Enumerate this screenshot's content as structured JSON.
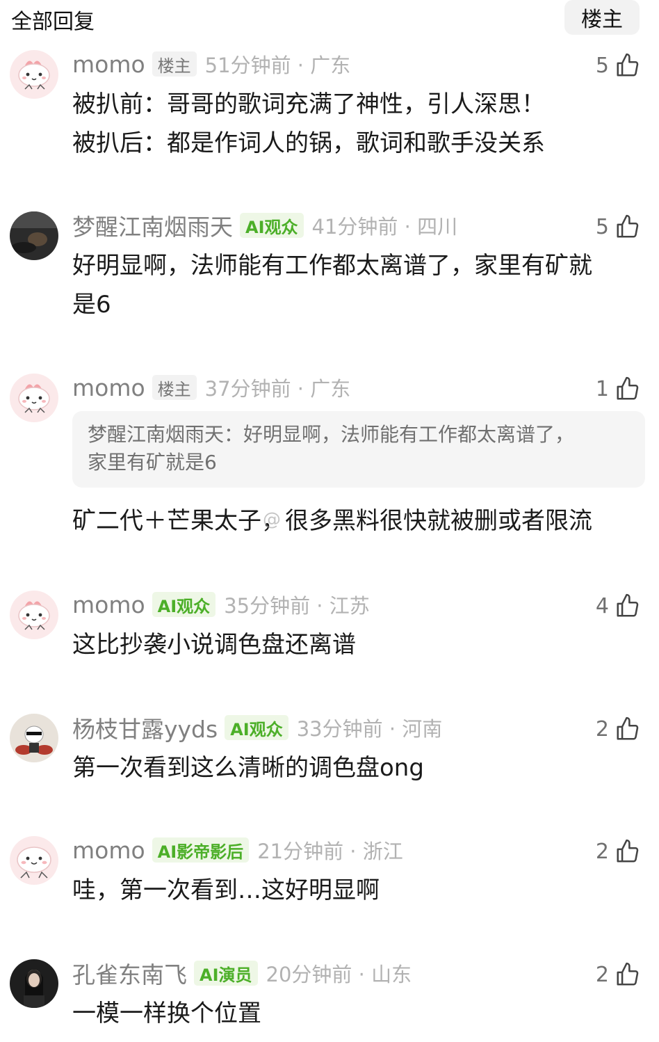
{
  "header": {
    "title": "全部回复",
    "filter_button": "楼主"
  },
  "watermark": "@",
  "comments": [
    {
      "username": "momo",
      "badge": "楼主",
      "badge_type": "op",
      "time": "51分钟前 · 广东",
      "likes": "5",
      "lines": [
        "被扒前：哥哥的歌词充满了神性，引人深思！",
        "被扒后：都是作词人的锅，歌词和歌手没关系"
      ],
      "avatar": "pink-cartoon-avatar"
    },
    {
      "username": "梦醒江南烟雨天",
      "badge": "AI观众",
      "badge_type": "ai",
      "time": "41分钟前 · 四川",
      "likes": "5",
      "lines": [
        "好明显啊，法师能有工作都太离谱了，家里有矿就",
        "是6"
      ],
      "avatar": "dark-photo-avatar"
    },
    {
      "username": "momo",
      "badge": "楼主",
      "badge_type": "op",
      "time": "37分钟前 · 广东",
      "likes": "1",
      "quote": [
        "梦醒江南烟雨天：好明显啊，法师能有工作都太离谱了，",
        "家里有矿就是6"
      ],
      "lines": [
        "矿二代＋芒果太子，很多黑料很快就被删或者限流"
      ],
      "avatar": "pink-cartoon-avatar"
    },
    {
      "username": "momo",
      "badge": "AI观众",
      "badge_type": "ai",
      "time": "35分钟前 · 江苏",
      "likes": "4",
      "lines": [
        "这比抄袭小说调色盘还离谱"
      ],
      "avatar": "pink-cartoon-avatar"
    },
    {
      "username": "杨枝甘露yyds",
      "badge": "AI观众",
      "badge_type": "ai",
      "time": "33分钟前 · 河南",
      "likes": "2",
      "lines": [
        "第一次看到这么清晰的调色盘ong"
      ],
      "avatar": "cat-drummer-avatar"
    },
    {
      "username": "momo",
      "badge": "AI影帝影后",
      "badge_type": "ai",
      "time": "21分钟前 · 浙江",
      "likes": "2",
      "lines": [
        "哇，第一次看到…这好明显啊"
      ],
      "avatar": "pink-cartoon-avatar"
    },
    {
      "username": "孔雀东南飞",
      "badge": "AI演员",
      "badge_type": "ai",
      "time": "20分钟前 · 山东",
      "likes": "2",
      "lines": [
        "一模一样换个位置"
      ],
      "avatar": "dark-portrait-avatar"
    }
  ],
  "colors": {
    "ai_badge_text": "#4caf28",
    "ai_badge_bg": "#eef7e6",
    "meta_gray": "#b2b2b2"
  }
}
